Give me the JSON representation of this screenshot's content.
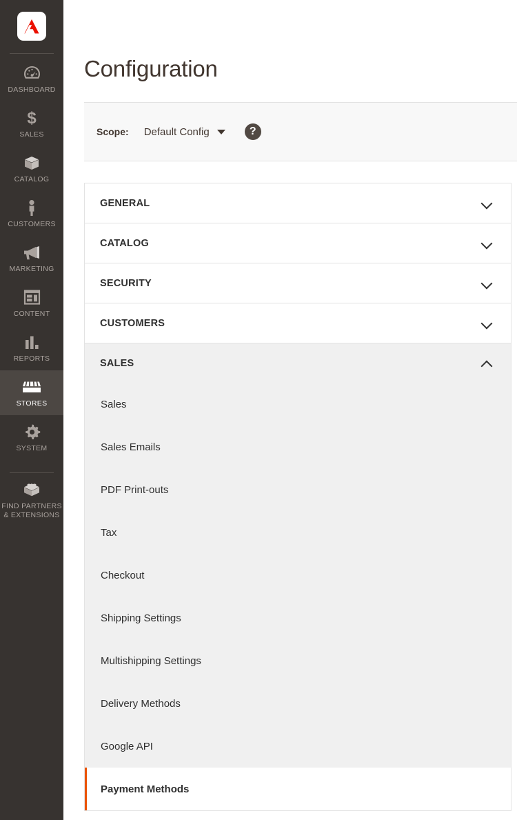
{
  "sidebar": {
    "logo_name": "adobe-commerce-logo",
    "items": [
      {
        "label": "DASHBOARD",
        "icon": "dashboard-gauge-icon",
        "active": false
      },
      {
        "label": "SALES",
        "icon": "dollar-sign-icon",
        "active": false
      },
      {
        "label": "CATALOG",
        "icon": "box-icon",
        "active": false
      },
      {
        "label": "CUSTOMERS",
        "icon": "person-icon",
        "active": false
      },
      {
        "label": "MARKETING",
        "icon": "megaphone-icon",
        "active": false
      },
      {
        "label": "CONTENT",
        "icon": "layout-window-icon",
        "active": false
      },
      {
        "label": "REPORTS",
        "icon": "bar-chart-icon",
        "active": false
      },
      {
        "label": "STORES",
        "icon": "storefront-icon",
        "active": true
      },
      {
        "label": "SYSTEM",
        "icon": "gear-icon",
        "active": false
      },
      {
        "label": "FIND PARTNERS\n& EXTENSIONS",
        "icon": "lego-brick-icon",
        "active": false
      }
    ]
  },
  "page": {
    "title": "Configuration"
  },
  "scope": {
    "label": "Scope:",
    "value": "Default Config",
    "caret_icon": "chevron-down-icon",
    "help_icon": "question-mark-icon",
    "help_glyph": "?"
  },
  "accordion": {
    "sections": [
      {
        "title": "GENERAL",
        "open": false,
        "items": []
      },
      {
        "title": "CATALOG",
        "open": false,
        "items": []
      },
      {
        "title": "SECURITY",
        "open": false,
        "items": []
      },
      {
        "title": "CUSTOMERS",
        "open": false,
        "items": []
      },
      {
        "title": "SALES",
        "open": true,
        "items": [
          {
            "label": "Sales",
            "current": false
          },
          {
            "label": "Sales Emails",
            "current": false
          },
          {
            "label": "PDF Print-outs",
            "current": false
          },
          {
            "label": "Tax",
            "current": false
          },
          {
            "label": "Checkout",
            "current": false
          },
          {
            "label": "Shipping Settings",
            "current": false
          },
          {
            "label": "Multishipping Settings",
            "current": false
          },
          {
            "label": "Delivery Methods",
            "current": false
          },
          {
            "label": "Google API",
            "current": false
          },
          {
            "label": "Payment Methods",
            "current": true
          }
        ]
      }
    ]
  },
  "colors": {
    "sidebar_bg": "#373330",
    "sidebar_active_bg": "#4c4743",
    "accent_orange": "#eb5202",
    "logo_red": "#eb1000",
    "panel_gray": "#f0f0f0",
    "scope_bg": "#f8f8f8",
    "text_dark": "#303030"
  }
}
